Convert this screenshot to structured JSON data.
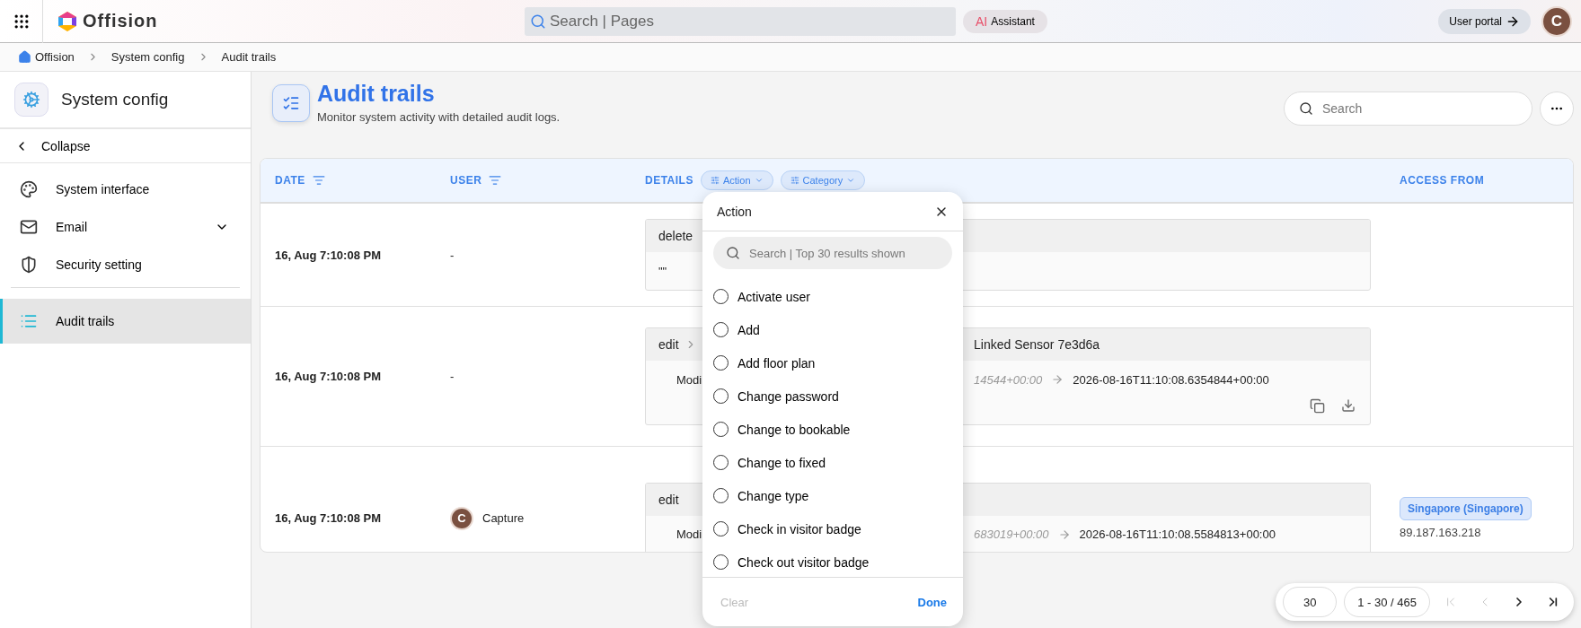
{
  "topbar": {
    "logo": "Offision",
    "search": {
      "placeholder": "Search | Pages"
    },
    "assistant": {
      "badge": "AI",
      "label": "Assistant"
    },
    "portal": "User portal",
    "avatar": "C"
  },
  "breadcrumb": [
    "Offision",
    "System config",
    "Audit trails"
  ],
  "sidebar": {
    "title": "System config",
    "collapse": "Collapse",
    "items": [
      {
        "label": "System interface",
        "kind": "palette",
        "expandable": false,
        "selected": false
      },
      {
        "label": "Email",
        "kind": "mail",
        "expandable": true,
        "selected": false
      },
      {
        "label": "Security setting",
        "kind": "shield",
        "expandable": false,
        "selected": false
      },
      {
        "label": "Audit trails",
        "kind": "list",
        "expandable": false,
        "selected": true
      }
    ]
  },
  "page": {
    "title": "Audit trails",
    "subtitle": "Monitor system activity with detailed audit logs.",
    "search": {
      "placeholder": "Search"
    }
  },
  "table": {
    "columns": [
      {
        "label": "DATE",
        "filter": true
      },
      {
        "label": "USER",
        "filter": true
      },
      {
        "label": "DETAILS",
        "filter": false,
        "chips": [
          "Action",
          "Category"
        ]
      },
      {
        "label": "ACCESS FROM",
        "filter": false
      }
    ],
    "rows": [
      {
        "date": "16, Aug 7:10:08 PM",
        "user": {
          "name": "-"
        },
        "detail": {
          "action": "delete",
          "body": "\"\""
        }
      },
      {
        "date": "16, Aug 7:10:08 PM",
        "user": {
          "name": "-"
        },
        "detail": {
          "action": "edit",
          "title": "Linked Sensor 7e3d6a",
          "label": "Modi",
          "old": "14544+00:00",
          "new": "2026-08-16T11:10:08.6354844+00:00",
          "tools": true
        }
      },
      {
        "date": "16, Aug 7:10:08 PM",
        "user": {
          "name": "Capture",
          "avatar": "C"
        },
        "detail": {
          "action": "edit",
          "label": "Modi",
          "old": "683019+00:00",
          "new": "2026-08-16T11:10:08.5584813+00:00",
          "tools": false
        },
        "access": {
          "location": "Singapore (Singapore)",
          "ip": "89.187.163.218"
        }
      }
    ]
  },
  "popup": {
    "title": "Action",
    "search": {
      "placeholder": "Search | Top 30 results shown"
    },
    "options": [
      {
        "label": "Activate user",
        "selected": false
      },
      {
        "label": "Add",
        "selected": false
      },
      {
        "label": "Add floor plan",
        "selected": false
      },
      {
        "label": "Change password",
        "selected": false
      },
      {
        "label": "Change to bookable",
        "selected": false
      },
      {
        "label": "Change to fixed",
        "selected": false
      },
      {
        "label": "Change type",
        "selected": false
      },
      {
        "label": "Check in visitor badge",
        "selected": false
      },
      {
        "label": "Check out visitor badge",
        "selected": false
      }
    ],
    "clear": {
      "label": "Clear",
      "disabled": true
    },
    "done": "Done"
  },
  "pagination": {
    "page_size": "30",
    "range": "1 - 30 / 465",
    "buttons": [
      {
        "kind": "first",
        "disabled": true
      },
      {
        "kind": "prev",
        "disabled": true
      },
      {
        "kind": "next",
        "disabled": false
      },
      {
        "kind": "last",
        "disabled": false
      }
    ]
  }
}
